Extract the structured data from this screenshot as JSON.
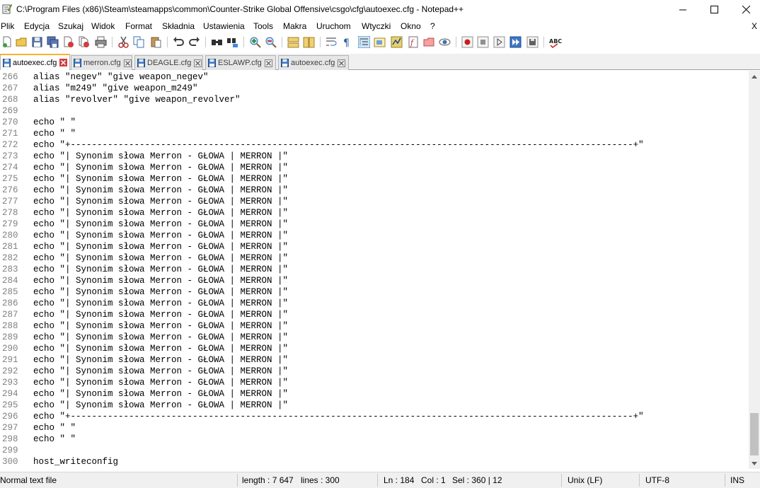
{
  "window": {
    "title": "C:\\Program Files (x86)\\Steam\\steamapps\\common\\Counter-Strike Global Offensive\\csgo\\cfg\\autoexec.cfg - Notepad++",
    "minimize": "—",
    "maximize": "☐",
    "close": "✕"
  },
  "menu": {
    "items": [
      "Plik",
      "Edycja",
      "Szukaj",
      "Widok",
      "Format",
      "Składnia",
      "Ustawienia",
      "Tools",
      "Makra",
      "Uruchom",
      "Wtyczki",
      "Okno",
      "?"
    ],
    "close_label": "X"
  },
  "toolbar": {
    "icons": [
      "new-file-icon",
      "open-file-icon",
      "save-icon",
      "save-all-icon",
      "close-icon",
      "close-all-icon",
      "print-icon",
      "cut-icon",
      "copy-icon",
      "paste-icon",
      "undo-icon",
      "redo-icon",
      "find-icon",
      "replace-icon",
      "zoom-in-icon",
      "zoom-out-icon",
      "sync-vertical-icon",
      "sync-horizontal-icon",
      "word-wrap-icon",
      "show-all-characters-icon",
      "indent-guide-icon",
      "udl-icon",
      "doc-map-icon",
      "function-list-icon",
      "folder-workspace-icon",
      "monitoring-icon",
      "record-macro-icon",
      "stop-macro-icon",
      "play-macro-icon",
      "run-macro-multiple-icon",
      "save-macro-icon",
      "spell-check-icon"
    ],
    "spell_label": "ABC"
  },
  "tabs": [
    {
      "label": "autoexec.cfg",
      "active": true
    },
    {
      "label": "merron.cfg",
      "active": false
    },
    {
      "label": "DEAGLE.cfg",
      "active": false
    },
    {
      "label": "ESLAWP.cfg",
      "active": false
    },
    {
      "label": "autoexec.cfg",
      "active": false
    }
  ],
  "editor": {
    "lines": [
      {
        "num": "266",
        "text": "alias \"negev\" \"give weapon_negev\""
      },
      {
        "num": "267",
        "text": "alias \"m249\" \"give weapon_m249\""
      },
      {
        "num": "268",
        "text": "alias \"revolver\" \"give weapon_revolver\""
      },
      {
        "num": "269",
        "text": ""
      },
      {
        "num": "270",
        "text": "echo \" \""
      },
      {
        "num": "271",
        "text": "echo \" \""
      },
      {
        "num": "272",
        "text": "echo \"+----------------------------------------------------------------------------------------------------------+\""
      },
      {
        "num": "273",
        "text": "echo \"| Synonim słowa Merron - GŁOWA | MERRON |\""
      },
      {
        "num": "274",
        "text": "echo \"| Synonim słowa Merron - GŁOWA | MERRON |\""
      },
      {
        "num": "275",
        "text": "echo \"| Synonim słowa Merron - GŁOWA | MERRON |\""
      },
      {
        "num": "276",
        "text": "echo \"| Synonim słowa Merron - GŁOWA | MERRON |\""
      },
      {
        "num": "277",
        "text": "echo \"| Synonim słowa Merron - GŁOWA | MERRON |\""
      },
      {
        "num": "278",
        "text": "echo \"| Synonim słowa Merron - GŁOWA | MERRON |\""
      },
      {
        "num": "279",
        "text": "echo \"| Synonim słowa Merron - GŁOWA | MERRON |\""
      },
      {
        "num": "280",
        "text": "echo \"| Synonim słowa Merron - GŁOWA | MERRON |\""
      },
      {
        "num": "281",
        "text": "echo \"| Synonim słowa Merron - GŁOWA | MERRON |\""
      },
      {
        "num": "282",
        "text": "echo \"| Synonim słowa Merron - GŁOWA | MERRON |\""
      },
      {
        "num": "283",
        "text": "echo \"| Synonim słowa Merron - GŁOWA | MERRON |\""
      },
      {
        "num": "284",
        "text": "echo \"| Synonim słowa Merron - GŁOWA | MERRON |\""
      },
      {
        "num": "285",
        "text": "echo \"| Synonim słowa Merron - GŁOWA | MERRON |\""
      },
      {
        "num": "286",
        "text": "echo \"| Synonim słowa Merron - GŁOWA | MERRON |\""
      },
      {
        "num": "287",
        "text": "echo \"| Synonim słowa Merron - GŁOWA | MERRON |\""
      },
      {
        "num": "288",
        "text": "echo \"| Synonim słowa Merron - GŁOWA | MERRON |\""
      },
      {
        "num": "289",
        "text": "echo \"| Synonim słowa Merron - GŁOWA | MERRON |\""
      },
      {
        "num": "290",
        "text": "echo \"| Synonim słowa Merron - GŁOWA | MERRON |\""
      },
      {
        "num": "291",
        "text": "echo \"| Synonim słowa Merron - GŁOWA | MERRON |\""
      },
      {
        "num": "292",
        "text": "echo \"| Synonim słowa Merron - GŁOWA | MERRON |\""
      },
      {
        "num": "293",
        "text": "echo \"| Synonim słowa Merron - GŁOWA | MERRON |\""
      },
      {
        "num": "294",
        "text": "echo \"| Synonim słowa Merron - GŁOWA | MERRON |\""
      },
      {
        "num": "295",
        "text": "echo \"| Synonim słowa Merron - GŁOWA | MERRON |\""
      },
      {
        "num": "296",
        "text": "echo \"+----------------------------------------------------------------------------------------------------------+\""
      },
      {
        "num": "297",
        "text": "echo \" \""
      },
      {
        "num": "298",
        "text": "echo \" \""
      },
      {
        "num": "299",
        "text": ""
      },
      {
        "num": "300",
        "text": "host_writeconfig"
      }
    ]
  },
  "status": {
    "file_type": "Normal text file",
    "length": "length : 7 647",
    "lines": "lines : 300",
    "ln": "Ln : 184",
    "col": "Col : 1",
    "sel": "Sel : 360 | 12",
    "eol": "Unix (LF)",
    "encoding": "UTF-8",
    "mode": "INS"
  },
  "colors": {
    "active_tab_accent": "#fab428",
    "line_number": "#808080",
    "tab_icon_blue": "#3c78c8",
    "tab_close_red": "#c83232"
  }
}
